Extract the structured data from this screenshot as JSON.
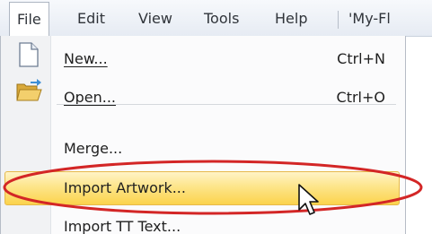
{
  "menubar": {
    "items": [
      {
        "label": "File"
      },
      {
        "label": "Edit"
      },
      {
        "label": "View"
      },
      {
        "label": "Tools"
      },
      {
        "label": "Help"
      },
      {
        "label": "'My-Fl"
      }
    ]
  },
  "file_menu": {
    "items": [
      {
        "label": "New...",
        "shortcut": "Ctrl+N",
        "icon": "new-document-icon"
      },
      {
        "label": "Open...",
        "shortcut": "Ctrl+O",
        "icon": "open-folder-icon"
      },
      {
        "label": "Merge..."
      },
      {
        "label": "Import Artwork...",
        "highlighted": true
      },
      {
        "label": "Import TT Text..."
      }
    ]
  },
  "annotation": {
    "shape": "red-ellipse",
    "target": "Import Artwork...",
    "color": "#d32626"
  },
  "colors": {
    "highlight": "#fde58a",
    "annotation": "#d32626",
    "menubar": "#e9eef5"
  }
}
